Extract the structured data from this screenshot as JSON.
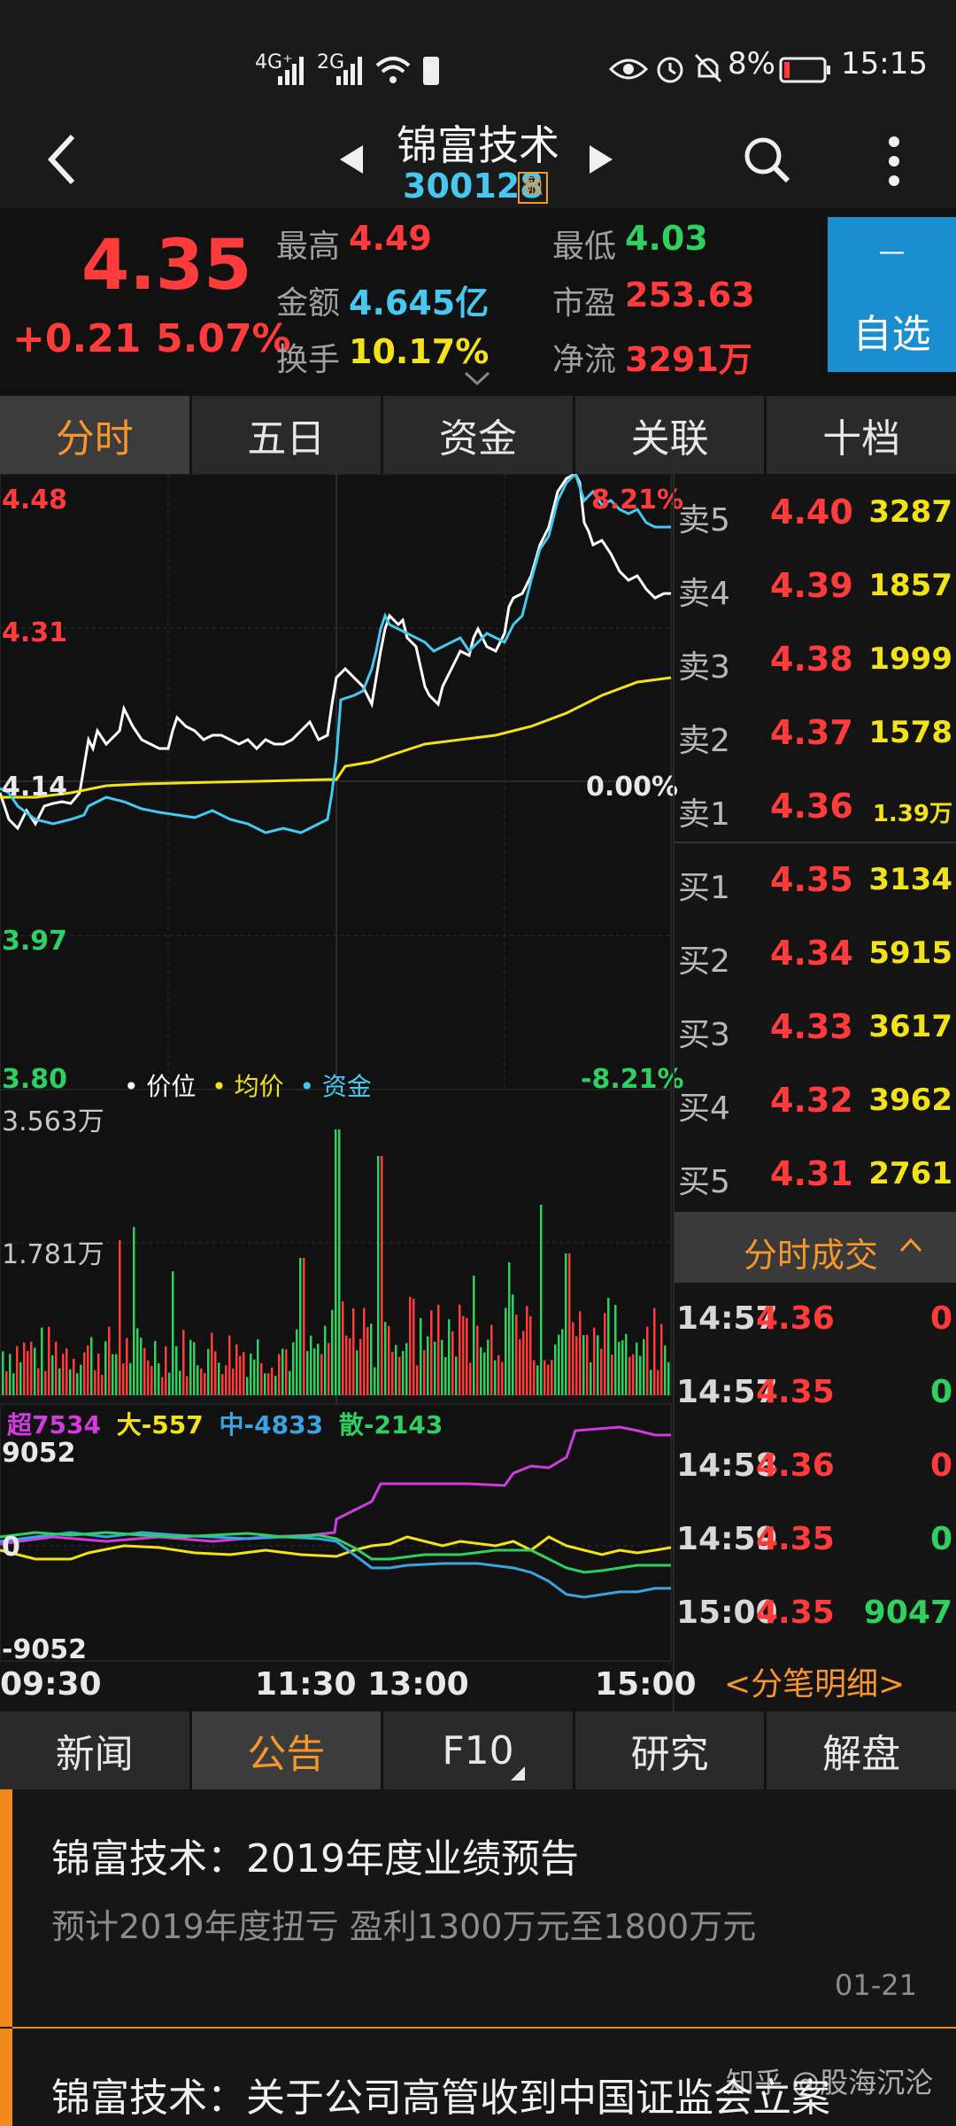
{
  "status_bar": {
    "net1": "4G⁺",
    "net2": "2G",
    "battery": "8%",
    "time": "15:15"
  },
  "header": {
    "stock_name": "锦富技术",
    "stock_code": "300128",
    "margin_badge": "融"
  },
  "quote": {
    "price": "4.35",
    "change": "+0.21",
    "change_pct": "5.07%",
    "high_label": "最高",
    "high": "4.49",
    "low_label": "最低",
    "low": "4.03",
    "amount_label": "金额",
    "amount": "4.645亿",
    "pe_label": "市盈",
    "pe": "253.63",
    "turnover_label": "换手",
    "turnover": "10.17%",
    "netflow_label": "净流",
    "netflow": "3291万",
    "fav_minus": "—",
    "fav_label": "自选"
  },
  "chart_tabs": [
    "分时",
    "五日",
    "资金",
    "关联",
    "十档"
  ],
  "price_axis": {
    "left": [
      "4.48",
      "4.31",
      "4.14",
      "3.97",
      "3.80"
    ],
    "right_top": "8.21%",
    "right_mid": "0.00%",
    "right_bottom": "-8.21%"
  },
  "legend": {
    "price": "价位",
    "avg": "均价",
    "fund": "资金"
  },
  "volume_axis": [
    "3.563万",
    "1.781万"
  ],
  "fund_legend": {
    "super": "超7534",
    "big": "大-557",
    "mid": "中-4833",
    "small": "散-2143"
  },
  "fund_axis": {
    "top": "9052",
    "zero": "0",
    "bottom": "-9052"
  },
  "time_axis": [
    "09:30",
    "11:30 13:00",
    "15:00"
  ],
  "order_book": {
    "asks": [
      {
        "label": "卖5",
        "price": "4.40",
        "vol": "3287"
      },
      {
        "label": "卖4",
        "price": "4.39",
        "vol": "1857"
      },
      {
        "label": "卖3",
        "price": "4.38",
        "vol": "1999"
      },
      {
        "label": "卖2",
        "price": "4.37",
        "vol": "1578"
      },
      {
        "label": "卖1",
        "price": "4.36",
        "vol": "1.39万"
      }
    ],
    "bids": [
      {
        "label": "买1",
        "price": "4.35",
        "vol": "3134"
      },
      {
        "label": "买2",
        "price": "4.34",
        "vol": "5915"
      },
      {
        "label": "买3",
        "price": "4.33",
        "vol": "3617"
      },
      {
        "label": "买4",
        "price": "4.32",
        "vol": "3962"
      },
      {
        "label": "买5",
        "price": "4.31",
        "vol": "2761"
      }
    ]
  },
  "trades_header": "分时成交",
  "trades": [
    {
      "time": "14:57",
      "price": "4.36",
      "vol": "0",
      "color": "#ff3b3b"
    },
    {
      "time": "14:57",
      "price": "4.35",
      "vol": "0",
      "color": "#2fd05f"
    },
    {
      "time": "14:58",
      "price": "4.36",
      "vol": "0",
      "color": "#ff3b3b"
    },
    {
      "time": "14:59",
      "price": "4.35",
      "vol": "0",
      "color": "#2fd05f"
    },
    {
      "time": "15:00",
      "price": "4.35",
      "vol": "9047",
      "color": "#2fd05f"
    }
  ],
  "trade_detail_link": "<分笔明细>",
  "news_tabs": [
    "新闻",
    "公告",
    "F10",
    "研究",
    "解盘"
  ],
  "news": [
    {
      "title": "锦富技术：2019年度业绩预告",
      "summary": "预计2019年度扭亏 盈利1300万元至1800万元",
      "date": "01-21"
    },
    {
      "title": "锦富技术：关于公司高管收到中国证监会立案"
    }
  ],
  "watermark": "知乎 @股海沉沦",
  "colors": {
    "up": "#ff3b3b",
    "down": "#2fd05f",
    "accent": "#f5962e",
    "price_line": "#ffffff",
    "avg_line": "#f2e21a",
    "fund_line": "#46c8f0",
    "super": "#d23be0",
    "big": "#f2e21a",
    "mid": "#3aa3e0",
    "small": "#2fd05f"
  }
}
